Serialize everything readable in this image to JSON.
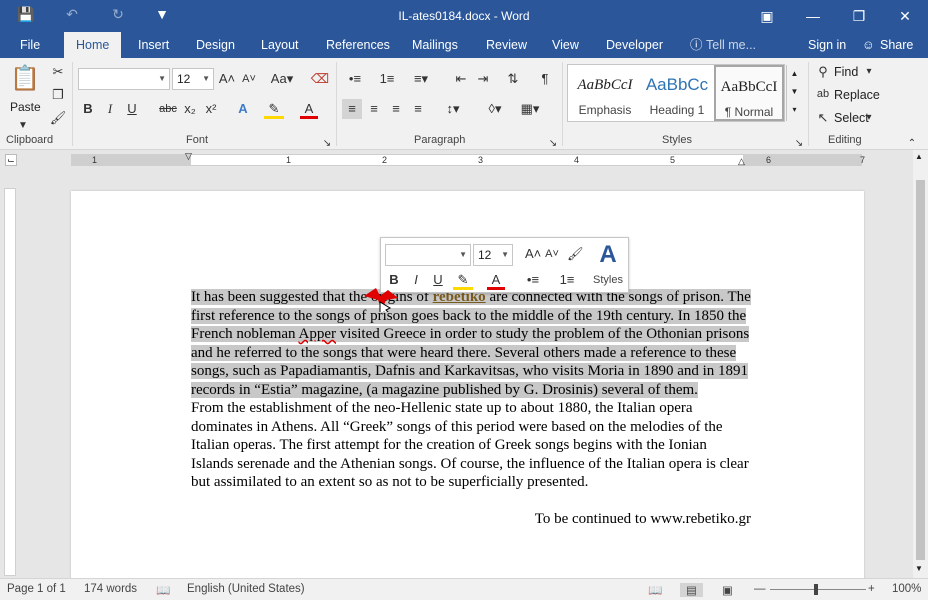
{
  "window": {
    "title": "IL-ates0184.docx - Word"
  },
  "tabs": {
    "file": "File",
    "home": "Home",
    "insert": "Insert",
    "design": "Design",
    "layout": "Layout",
    "references": "References",
    "mailings": "Mailings",
    "review": "Review",
    "view": "View",
    "developer": "Developer",
    "tell": "Tell me...",
    "signin": "Sign in",
    "share": "Share"
  },
  "ribbon": {
    "clipboard": {
      "paste": "Paste",
      "label": "Clipboard"
    },
    "font": {
      "name_value": "",
      "size_value": "12",
      "label": "Font",
      "change_case": "Aa"
    },
    "paragraph": {
      "label": "Paragraph"
    },
    "styles": {
      "label": "Styles",
      "items": [
        {
          "sample": "AaBbCcI",
          "name": "Emphasis"
        },
        {
          "sample": "AaBbCc",
          "name": "Heading 1"
        },
        {
          "sample": "AaBbCcI",
          "name": "¶ Normal"
        }
      ]
    },
    "editing": {
      "label": "Editing",
      "find": "Find",
      "replace": "Replace",
      "select": "Select"
    }
  },
  "ruler": {
    "marks": [
      "1",
      "1",
      "2",
      "3",
      "4",
      "5",
      "6",
      "7"
    ]
  },
  "mini_toolbar": {
    "size_value": "12",
    "styles": "Styles"
  },
  "document": {
    "p1_a": "It has been suggested that t",
    "p1_origins": "he origins of ",
    "p1_rebetiko": "rebetiko",
    "p1_b": " are connected with the songs of prison. The first reference to the songs of prison goes back to the middle of the 19th century. In 1850 the French nobleman ",
    "p1_apper": "Apper",
    "p1_c": " visited Greece in order to study the problem of the Othonian prisons and he referred to the songs that were heard there. Several others made a reference to these songs, such as Papadiamantis, Dafnis and Karkavitsas, who visits Moria in 1890 and in 1891 records in “Estia” magazine, (a magazine published by G. Drosinis) several of them.",
    "p2": "From the establishment of the neo-Hellenic state up to about 1880, the Italian opera dominates in Athens. All “Greek” songs of this period were based on the melodies of the Italian operas. The first attempt for the creation of Greek songs begins with the Ionian Islands serenade and the Athenian songs. Of course, the influence of the Italian opera is clear but assimilated to an extent so as not to be superficially presented.",
    "continued": "To be continued to www.rebetiko.gr"
  },
  "status": {
    "page": "Page 1 of 1",
    "words": "174 words",
    "language": "English (United States)",
    "zoom": "100%"
  },
  "colors": {
    "accent": "#2b579a"
  }
}
